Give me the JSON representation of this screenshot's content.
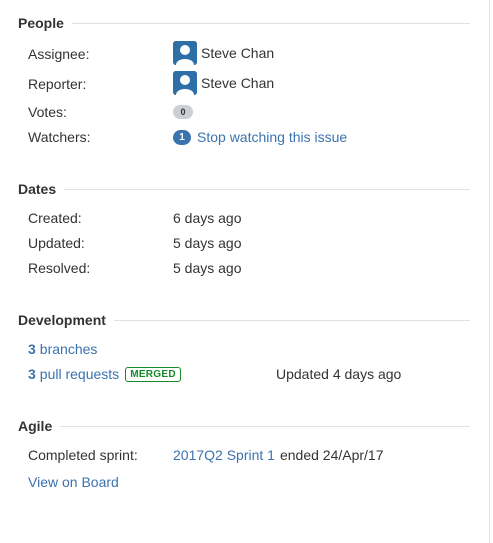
{
  "people": {
    "title": "People",
    "assignee_label": "Assignee:",
    "assignee_name": "Steve Chan",
    "reporter_label": "Reporter:",
    "reporter_name": "Steve Chan",
    "votes_label": "Votes:",
    "votes_count": "0",
    "watchers_label": "Watchers:",
    "watchers_count": "1",
    "watch_action": "Stop watching this issue"
  },
  "dates": {
    "title": "Dates",
    "created_label": "Created:",
    "created_value": "6 days ago",
    "updated_label": "Updated:",
    "updated_value": "5 days ago",
    "resolved_label": "Resolved:",
    "resolved_value": "5 days ago"
  },
  "development": {
    "title": "Development",
    "branches_count": "3",
    "branches_label": "branches",
    "pr_count": "3",
    "pr_label": "pull requests",
    "pr_status": "MERGED",
    "pr_updated": "Updated 4 days ago"
  },
  "agile": {
    "title": "Agile",
    "sprint_label": "Completed sprint:",
    "sprint_name": "2017Q2 Sprint 1",
    "sprint_end": "ended 24/Apr/17",
    "board_link": "View on Board"
  },
  "colors": {
    "link": "#3b73af",
    "merged": "#14892c",
    "rule": "#dfe1e5"
  },
  "icons": {
    "avatar": "user-avatar-icon"
  }
}
